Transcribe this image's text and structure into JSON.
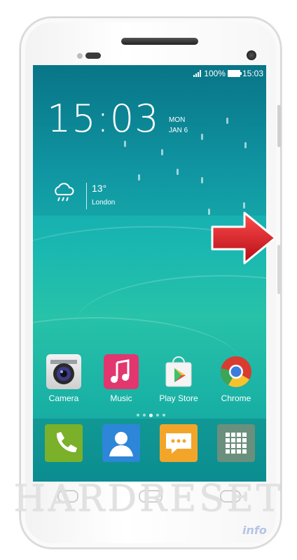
{
  "status_bar": {
    "battery": "100%",
    "time": "15:03"
  },
  "clock_widget": {
    "time": "15:03",
    "day": "MON",
    "date": "JAN 6"
  },
  "weather": {
    "temperature": "13°",
    "city": "London",
    "icon": "cloud-rain-icon"
  },
  "apps": [
    {
      "label": "Camera",
      "icon": "camera-icon"
    },
    {
      "label": "Music",
      "icon": "music-icon"
    },
    {
      "label": "Play Store",
      "icon": "play-store-icon"
    },
    {
      "label": "Chrome",
      "icon": "chrome-icon"
    }
  ],
  "page_indicator": {
    "count": 5,
    "active": 2
  },
  "dock": [
    {
      "icon": "phone-icon",
      "color": "#7ab02a"
    },
    {
      "icon": "contacts-icon",
      "color": "#2d86d8"
    },
    {
      "icon": "messages-icon",
      "color": "#f3a52a"
    },
    {
      "icon": "app-drawer-icon",
      "color": "#6a8f7d"
    }
  ],
  "watermark": {
    "text": "HARDRESET",
    "sub": "info"
  },
  "colors": {
    "accent_arrow": "#e3202a"
  }
}
